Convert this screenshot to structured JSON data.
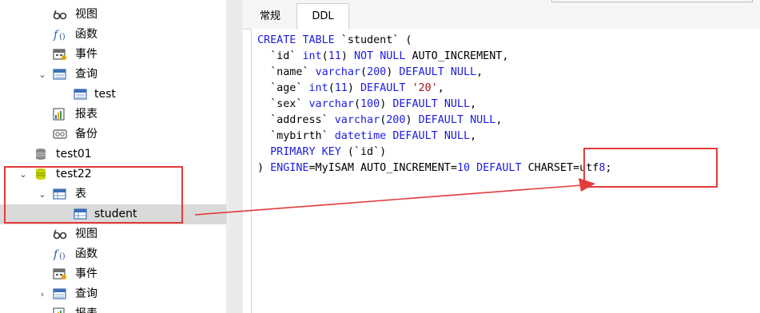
{
  "tree": {
    "items": [
      {
        "label": "视图",
        "icon": "view-icon"
      },
      {
        "label": "函数",
        "icon": "function-icon"
      },
      {
        "label": "事件",
        "icon": "event-icon"
      },
      {
        "label": "查询",
        "icon": "query-icon"
      },
      {
        "label": "test",
        "icon": "query-item-icon"
      },
      {
        "label": "报表",
        "icon": "report-icon"
      },
      {
        "label": "备份",
        "icon": "backup-icon"
      },
      {
        "label": "test01",
        "icon": "database-icon"
      },
      {
        "label": "test22",
        "icon": "database-open-icon"
      },
      {
        "label": "表",
        "icon": "table-group-icon"
      },
      {
        "label": "student",
        "icon": "table-icon"
      },
      {
        "label": "视图",
        "icon": "view-icon"
      },
      {
        "label": "函数",
        "icon": "function-icon"
      },
      {
        "label": "事件",
        "icon": "event-icon"
      },
      {
        "label": "查询",
        "icon": "query-icon"
      },
      {
        "label": "报表",
        "icon": "report-icon"
      }
    ]
  },
  "tabs": {
    "normal": "常规",
    "ddl": "DDL"
  },
  "ddl": {
    "lines": [
      "CREATE TABLE `student` (",
      "  `id` int(11) NOT NULL AUTO_INCREMENT,",
      "  `name` varchar(200) DEFAULT NULL,",
      "  `age` int(11) DEFAULT '20',",
      "  `sex` varchar(100) DEFAULT NULL,",
      "  `address` varchar(200) DEFAULT NULL,",
      "  `mybirth` datetime DEFAULT NULL,",
      "  PRIMARY KEY (`id`)",
      ") ENGINE=MyISAM AUTO_INCREMENT=10 DEFAULT CHARSET=utf8;"
    ]
  },
  "colors": {
    "keyword": "#1c1ce0",
    "string": "#a31515",
    "annotation": "#e33b3b",
    "selected_row": "#d9d9d9"
  }
}
